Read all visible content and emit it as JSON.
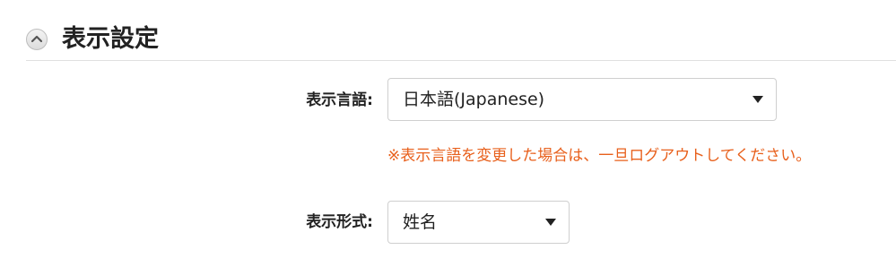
{
  "section": {
    "title": "表示設定",
    "collapse_icon": "chevron-up-icon"
  },
  "language": {
    "label": "表示言語:",
    "selected": "日本語(Japanese)",
    "note": "※表示言語を変更した場合は、一旦ログアウトしてください。"
  },
  "format": {
    "label": "表示形式:",
    "selected": "姓名"
  },
  "colors": {
    "note": "#e8601c",
    "text": "#222222",
    "divider": "#e0e0e0",
    "select_border": "#cfcfcf"
  }
}
